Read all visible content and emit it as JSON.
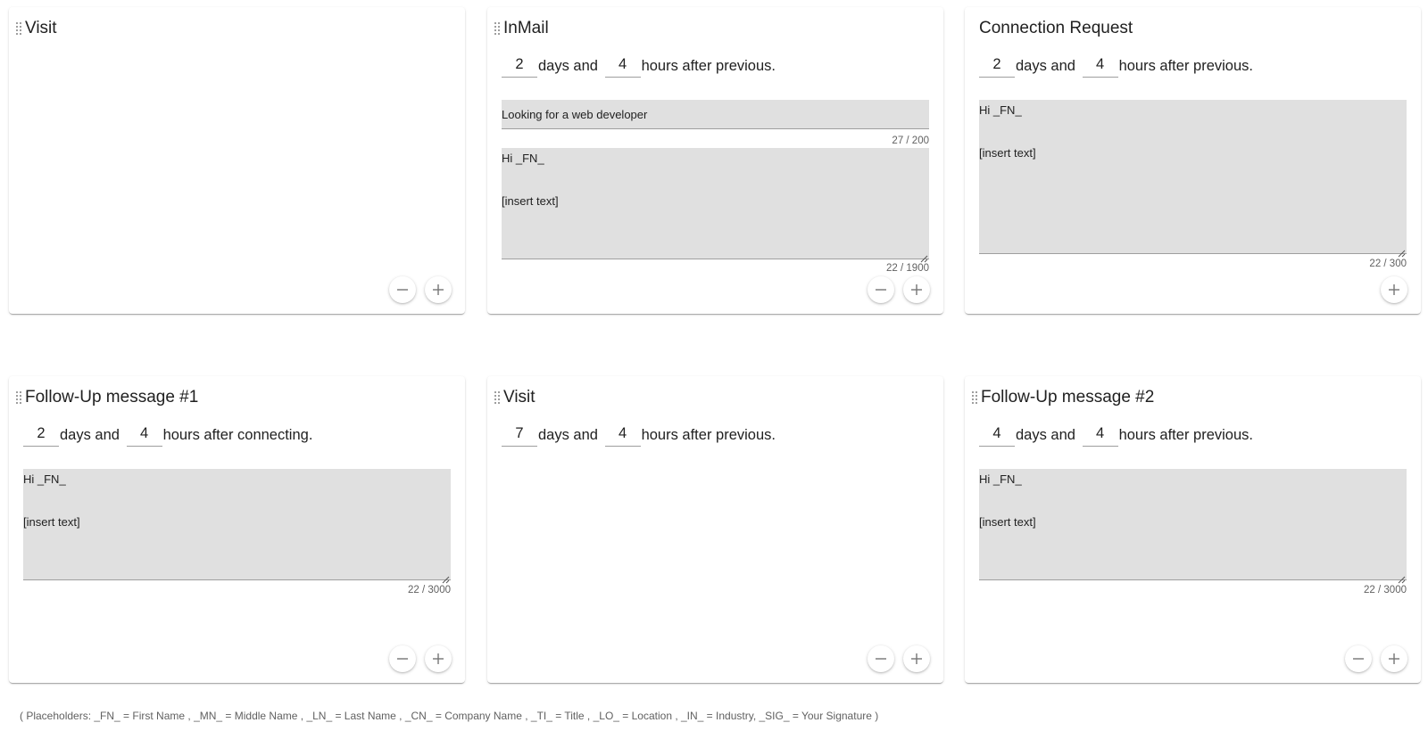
{
  "cards": [
    {
      "title": "Visit",
      "minus_icon": "minus-icon",
      "plus_icon": "plus-icon"
    },
    {
      "title": "InMail",
      "days": "2",
      "days_text": "days and",
      "hours": "4",
      "hours_text": "hours after previous.",
      "subject": "Looking for a web developer",
      "subject_counter": "27 / 200",
      "message": "Hi _FN_\n\n\n[insert text]",
      "message_counter": "22 / 1900"
    },
    {
      "title": "Connection Request",
      "days": "2",
      "days_text": "days and",
      "hours": "4",
      "hours_text": "hours after previous.",
      "message": "Hi _FN_\n\n\n[insert text]",
      "message_counter": "22 / 300"
    },
    {
      "title": "Follow-Up message #1",
      "days": "2",
      "days_text": "days and",
      "hours": "4",
      "hours_text": "hours after connecting.",
      "message": "Hi _FN_\n\n\n[insert text]",
      "message_counter": "22 / 3000"
    },
    {
      "title": "Visit",
      "days": "7",
      "days_text": "days and",
      "hours": "4",
      "hours_text": "hours after previous."
    },
    {
      "title": "Follow-Up message #2",
      "days": "4",
      "days_text": "days and",
      "hours": "4",
      "hours_text": "hours after previous.",
      "message": "Hi _FN_\n\n\n[insert text]",
      "message_counter": "22 / 3000"
    }
  ],
  "placeholders_legend": "( Placeholders: _FN_ = First Name , _MN_ = Middle Name , _LN_ = Last Name , _CN_ = Company Name , _TI_ = Title , _LO_ = Location , _IN_ = Industry, _SIG_ = Your Signature )",
  "colors": {
    "field_bg": "#e0e0e0",
    "text": "#212121",
    "muted": "#616161"
  }
}
